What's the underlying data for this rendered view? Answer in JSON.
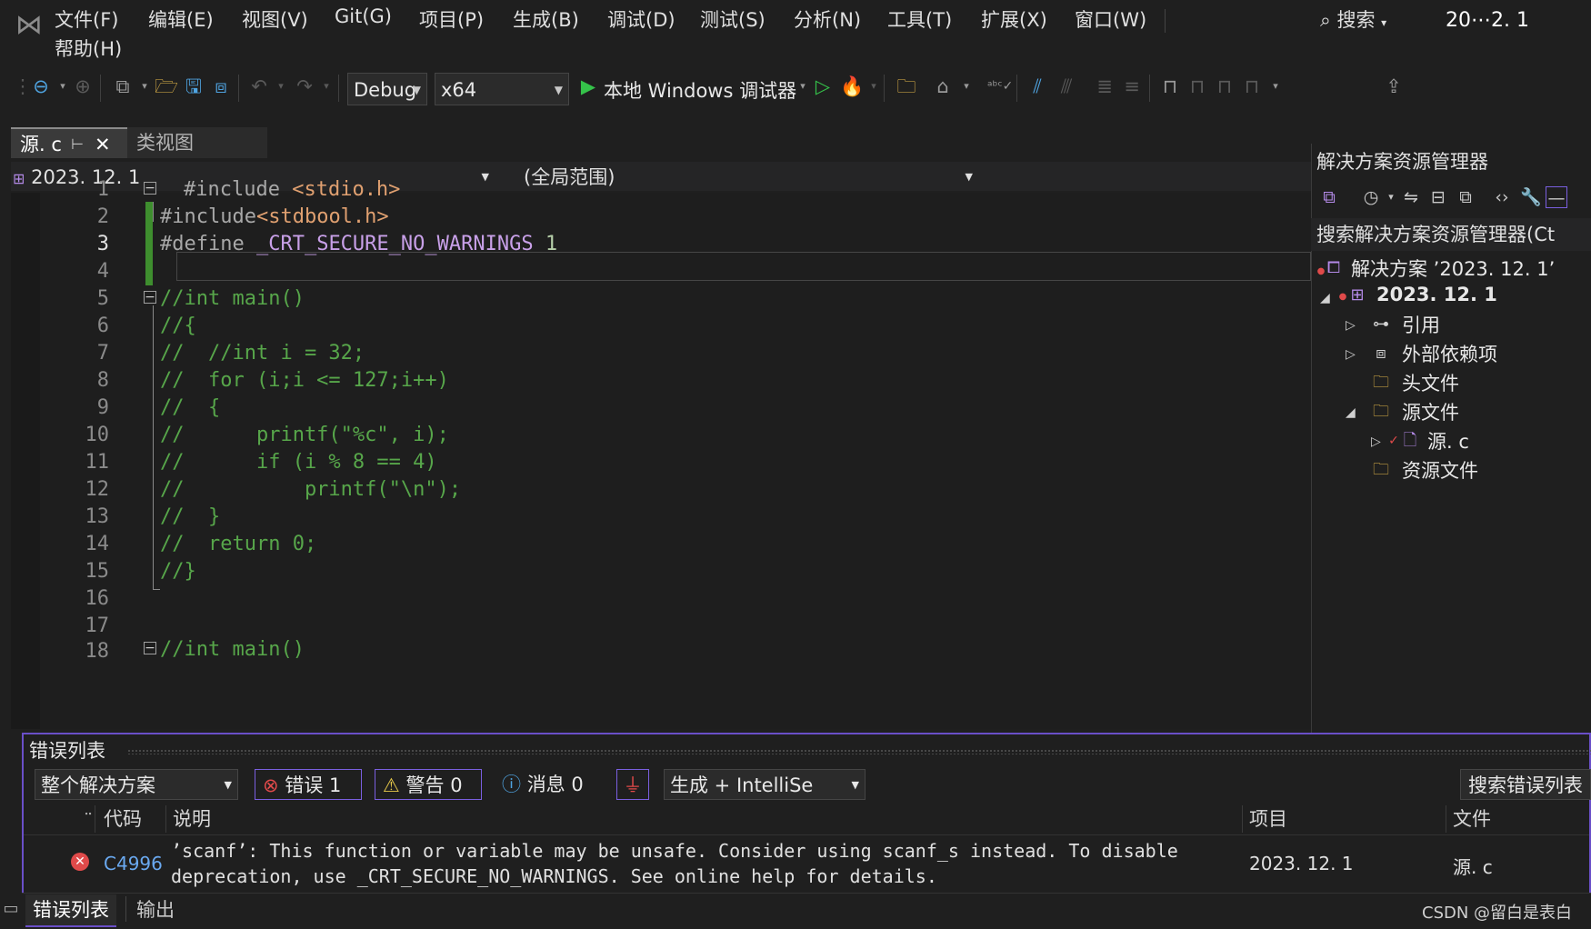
{
  "menu": {
    "items": [
      "文件(F)",
      "编辑(E)",
      "视图(V)",
      "Git(G)",
      "项目(P)",
      "生成(B)",
      "调试(D)",
      "测试(S)",
      "分析(N)",
      "工具(T)",
      "扩展(X)",
      "窗口(W)"
    ],
    "help": "帮助(H)",
    "search": "搜索",
    "window_title": "20⋯2. 1"
  },
  "toolbar": {
    "config": "Debug",
    "platform": "x64",
    "run_label": "本地 Windows 调试器"
  },
  "tabs": {
    "active": "源. c",
    "class_view": "类视图"
  },
  "navbar": {
    "project": "2023. 12. 1",
    "scope": "(全局范围)"
  },
  "editor": {
    "line_numbers": [
      "1",
      "2",
      "3",
      "4",
      "5",
      "6",
      "7",
      "8",
      "9",
      "10",
      "11",
      "12",
      "13",
      "14",
      "15",
      "16",
      "17",
      "18"
    ],
    "lines": {
      "l1_pp": "#include ",
      "l1_str": "<stdio.h>",
      "l2_pp": "#include",
      "l2_str": "<stdbool.h>",
      "l3_pp": "#define ",
      "l3_macro": "_CRT_SECURE_NO_WARNINGS",
      "l3_num": " 1",
      "l5": "//int main()",
      "l6": "//{",
      "l7": "//  //int i = 32;",
      "l8": "//  for (i;i <= 127;i++)",
      "l9": "//  {",
      "l10": "//      printf(\"%c\", i);",
      "l11": "//      if (i % 8 == 4)",
      "l12": "//          printf(\"\\n\");",
      "l13": "//  }",
      "l14": "//  return 0;",
      "l15": "//}",
      "l18": "//int main()"
    }
  },
  "solution_explorer": {
    "title": "解决方案资源管理器",
    "search_placeholder": "搜索解决方案资源管理器(Ct",
    "solution": "解决方案 ’2023. 12. 1’",
    "project": "2023. 12. 1",
    "nodes": [
      "引用",
      "外部依赖项",
      "头文件",
      "源文件",
      "源. c",
      "资源文件"
    ]
  },
  "error_list": {
    "title": "错误列表",
    "scope": "整个解决方案",
    "errors": "错误 1",
    "warnings": "警告 0",
    "messages": "消息 0",
    "source_filter": "生成 + IntelliSe",
    "search": "搜索错误列表",
    "columns": {
      "code": "代码",
      "desc": "说明",
      "project": "项目",
      "file": "文件"
    },
    "row": {
      "code": "C4996",
      "desc_line1": "’scanf’: This function or variable may be unsafe. Consider using scanf_s instead. To disable",
      "desc_line2": "deprecation, use _CRT_SECURE_NO_WARNINGS. See online help for details.",
      "project": "2023. 12. 1",
      "file": "源. c"
    }
  },
  "bottom_tabs": {
    "errors": "错误列表",
    "output": "输出"
  },
  "watermark": "CSDN @留白是表白",
  "colors": {
    "accent": "#6a4fc8",
    "error": "#e04a4a",
    "comment": "#57a64a",
    "string": "#e0a070"
  }
}
